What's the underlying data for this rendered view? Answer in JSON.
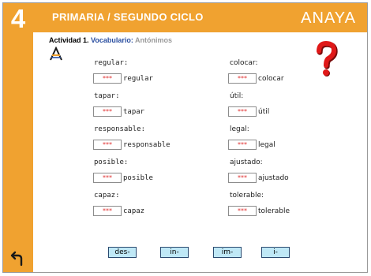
{
  "header": {
    "grade": "4",
    "title": "PRIMARIA / SEGUNDO CICLO",
    "brand": "ANAYA"
  },
  "activity": {
    "label": "Actividad 1.",
    "topic": "Vocabulario:",
    "subtopic": "Antónimos"
  },
  "colors": {
    "accent": "#f0a230",
    "topic_blue": "#2a4ea0",
    "answer_red": "#e03030",
    "button_fill": "#bfe8f6",
    "help_red": "#e01818"
  },
  "icons": {
    "back": "return-arrow-icon",
    "help": "question-mark-icon",
    "logo": "anaya-logo-icon"
  },
  "left_words": [
    {
      "label": "regular:",
      "placeholder": "***",
      "word": "regular"
    },
    {
      "label": "tapar:",
      "placeholder": "***",
      "word": "tapar"
    },
    {
      "label": "responsable:",
      "placeholder": "***",
      "word": "responsable"
    },
    {
      "label": "posible:",
      "placeholder": "***",
      "word": "posible"
    },
    {
      "label": "capaz:",
      "placeholder": "***",
      "word": "capaz"
    }
  ],
  "right_words": [
    {
      "label": "colocar:",
      "placeholder": "***",
      "word": "colocar"
    },
    {
      "label": "útil:",
      "placeholder": "***",
      "word": "útil"
    },
    {
      "label": "legal:",
      "placeholder": "***",
      "word": "legal"
    },
    {
      "label": "ajustado:",
      "placeholder": "***",
      "word": "ajustado"
    },
    {
      "label": "tolerable:",
      "placeholder": "***",
      "word": "tolerable"
    }
  ],
  "prefixes": [
    "des-",
    "in-",
    "im-",
    "i-"
  ]
}
